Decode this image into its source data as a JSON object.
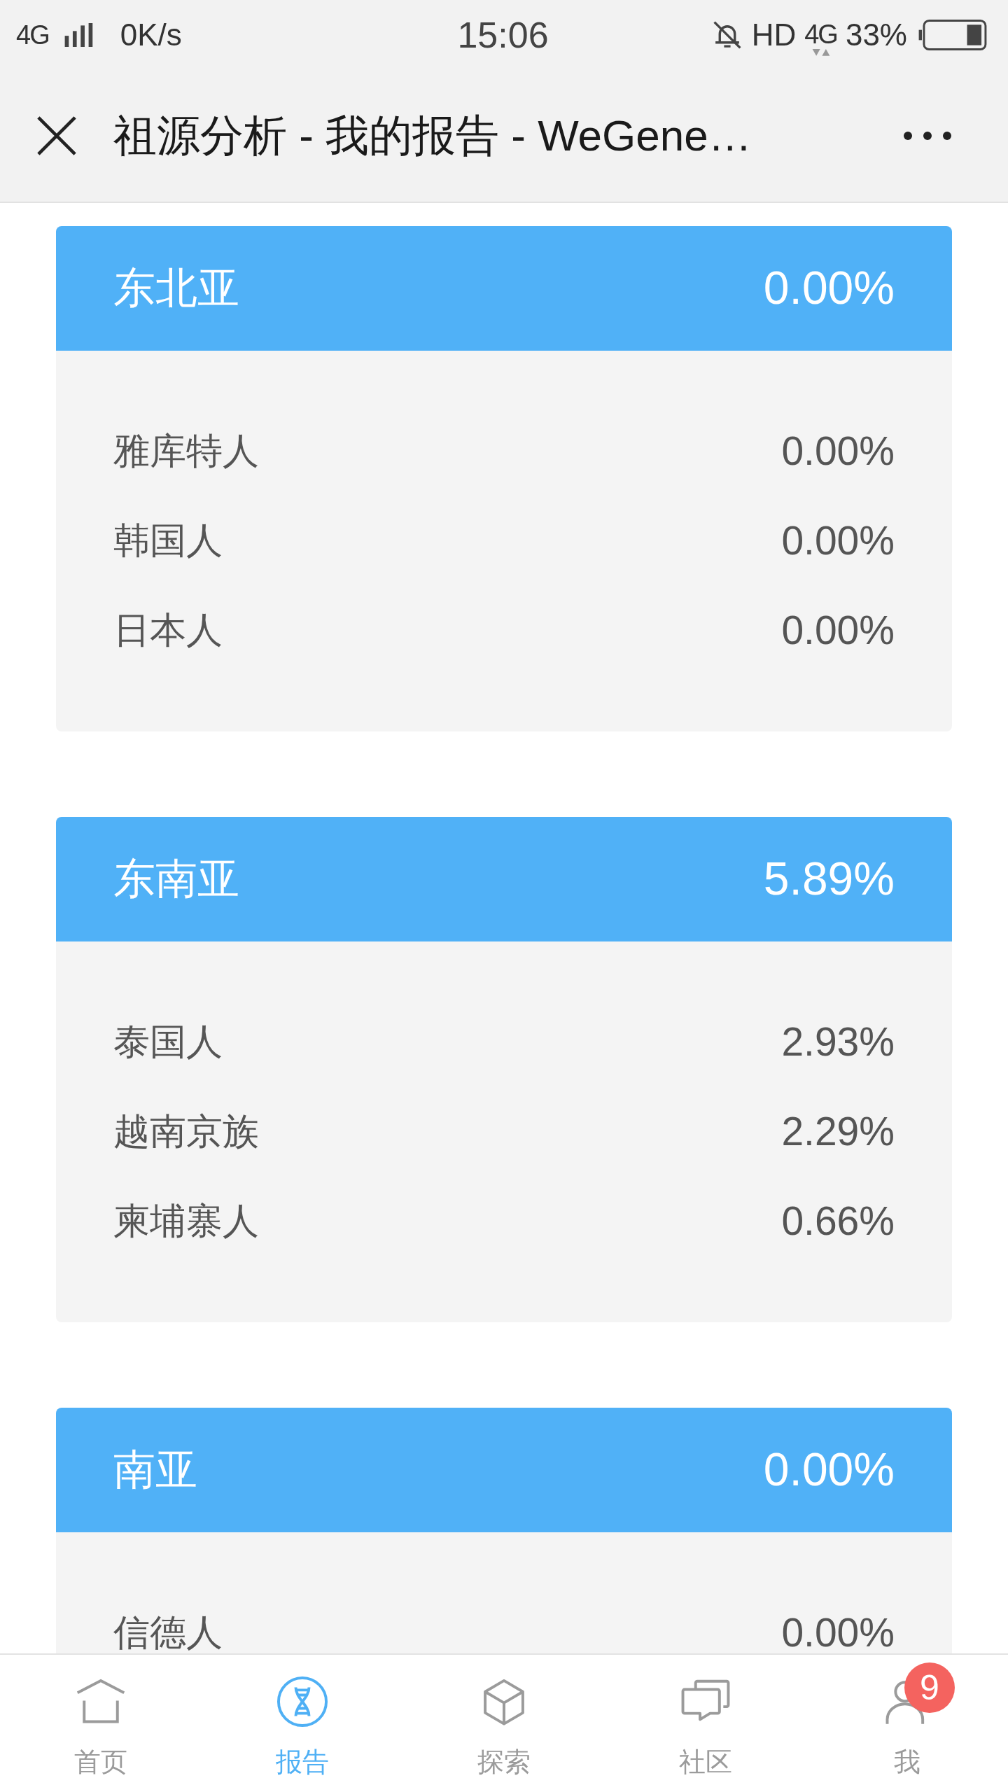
{
  "status_bar": {
    "network_left": "4G",
    "speed": "0K/s",
    "time": "15:06",
    "hd": "HD",
    "network_right": "4G",
    "battery": "33%"
  },
  "title_bar": {
    "title": "祖源分析 - 我的报告 - WeGene…"
  },
  "regions": [
    {
      "name": "东北亚",
      "percent": "0.00%",
      "populations": [
        {
          "name": "雅库特人",
          "percent": "0.00%"
        },
        {
          "name": "韩国人",
          "percent": "0.00%"
        },
        {
          "name": "日本人",
          "percent": "0.00%"
        }
      ]
    },
    {
      "name": "东南亚",
      "percent": "5.89%",
      "populations": [
        {
          "name": "泰国人",
          "percent": "2.93%"
        },
        {
          "name": "越南京族",
          "percent": "2.29%"
        },
        {
          "name": "柬埔寨人",
          "percent": "0.66%"
        }
      ]
    },
    {
      "name": "南亚",
      "percent": "0.00%",
      "populations": [
        {
          "name": "信德人",
          "percent": "0.00%"
        }
      ]
    }
  ],
  "tab_bar": {
    "tabs": [
      {
        "label": "首页",
        "kind": "home",
        "selected": false
      },
      {
        "label": "报告",
        "kind": "report",
        "selected": true
      },
      {
        "label": "探索",
        "kind": "explore",
        "selected": false
      },
      {
        "label": "社区",
        "kind": "community",
        "selected": false
      },
      {
        "label": "我",
        "kind": "profile",
        "selected": false,
        "badge": "9"
      }
    ]
  }
}
